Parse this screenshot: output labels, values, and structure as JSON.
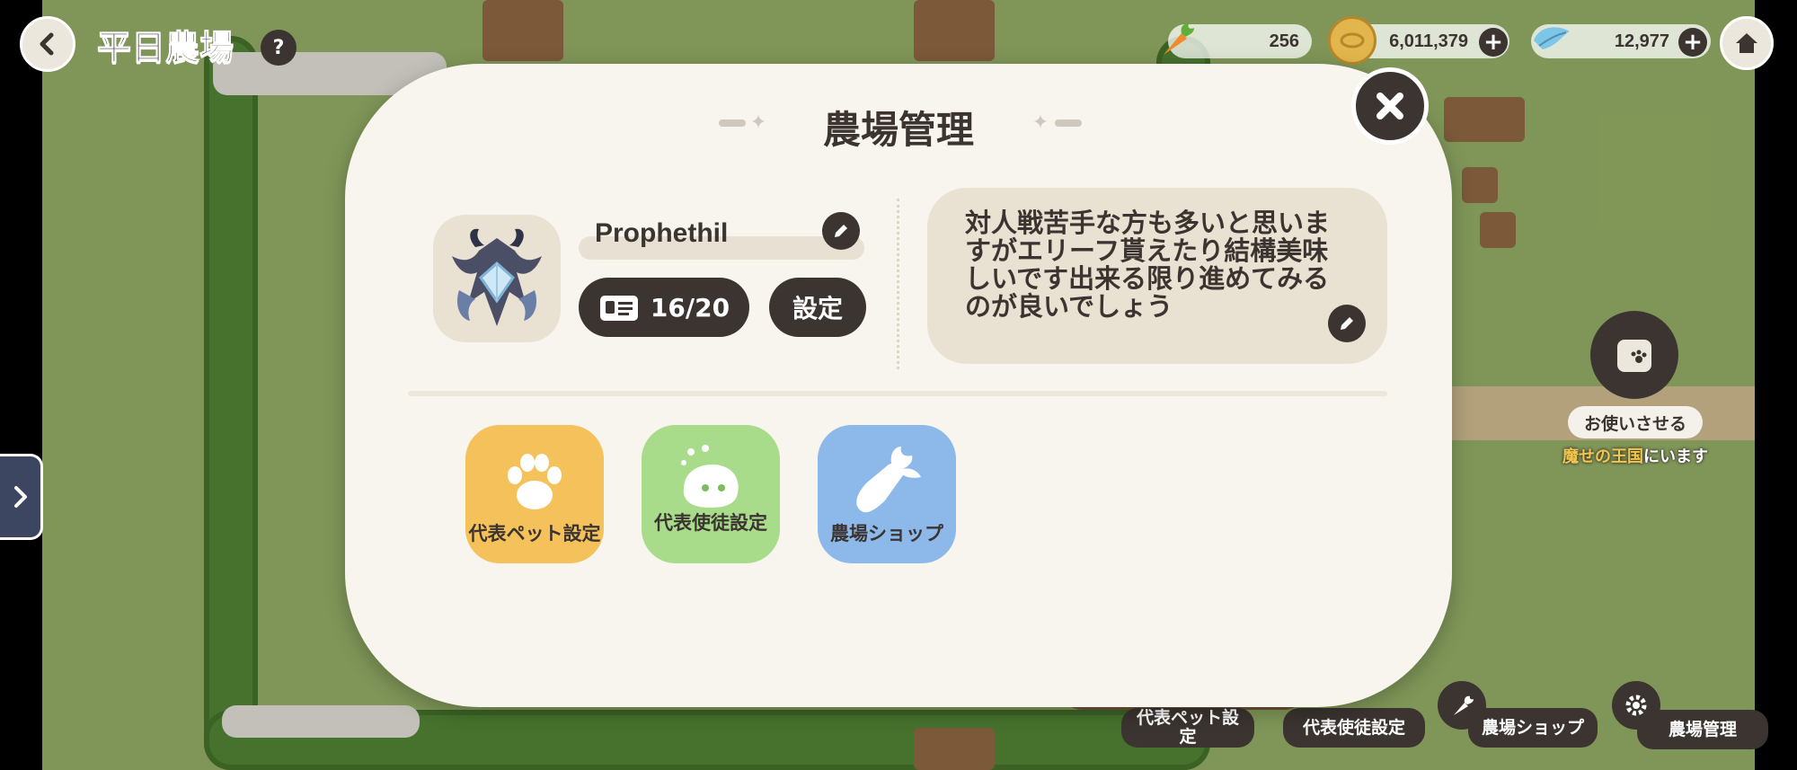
{
  "hud": {
    "page_title": "平日農場",
    "help_label": "?",
    "resources": [
      {
        "name": "carrot",
        "value": "256"
      },
      {
        "name": "coin",
        "value": "6,011,379"
      },
      {
        "name": "leaf",
        "value": "12,977"
      }
    ],
    "plus_label": "+"
  },
  "modal": {
    "title": "農場管理",
    "player_name": "Prophethil",
    "card_count": "16/20",
    "settings_label": "設定",
    "comment": "対人戦苦手な方も多いと思いますがエリーフ貰えたり結構美味しいです出来る限り進めてみるのが良いでしょう",
    "tiles": [
      {
        "label": "代表ペット設定",
        "color": "#f5c15a",
        "icon": "paw-icon"
      },
      {
        "label": "代表使徒設定",
        "color": "#a8dc8a",
        "icon": "mascot-icon"
      },
      {
        "label": "農場ショップ",
        "color": "#8db8ea",
        "icon": "carrot-icon"
      }
    ]
  },
  "npc": {
    "action_label": "お使いさせる",
    "location_name": "魔せの王国",
    "location_suffix": "にいます"
  },
  "bottom_bar": {
    "pet_label": "代表ペット設定",
    "apostle_label": "代表使徒設定",
    "shop_label": "農場ショップ",
    "manage_label": "農場管理"
  }
}
